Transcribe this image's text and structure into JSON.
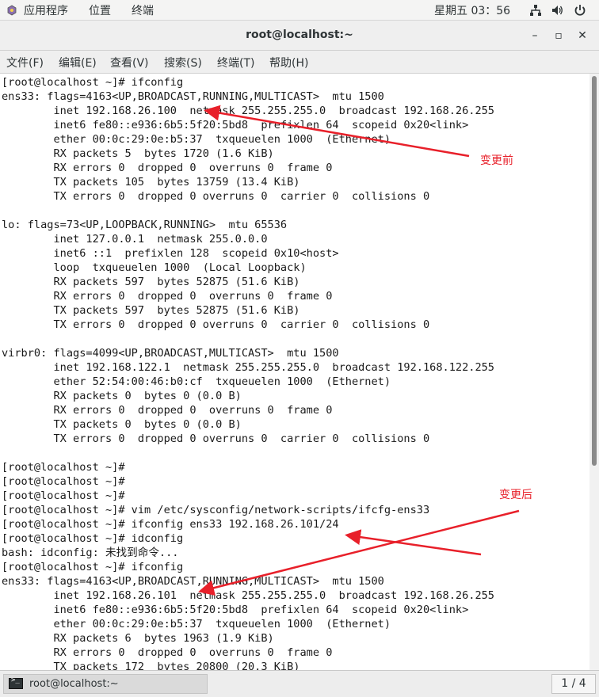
{
  "top_bar": {
    "apps_label": "应用程序",
    "places_label": "位置",
    "terminal_label": "终端",
    "clock": "星期五 03：56"
  },
  "window": {
    "title": "root@localhost:~",
    "minimize": "–",
    "maximize": "▫",
    "close": "✕"
  },
  "menu": [
    "文件(F)",
    "编辑(E)",
    "查看(V)",
    "搜索(S)",
    "终端(T)",
    "帮助(H)"
  ],
  "terminal_lines": [
    "[root@localhost ~]# ifconfig",
    "ens33: flags=4163<UP,BROADCAST,RUNNING,MULTICAST>  mtu 1500",
    "        inet 192.168.26.100  netmask 255.255.255.0  broadcast 192.168.26.255",
    "        inet6 fe80::e936:6b5:5f20:5bd8  prefixlen 64  scopeid 0x20<link>",
    "        ether 00:0c:29:0e:b5:37  txqueuelen 1000  (Ethernet)",
    "        RX packets 5  bytes 1720 (1.6 KiB)",
    "        RX errors 0  dropped 0  overruns 0  frame 0",
    "        TX packets 105  bytes 13759 (13.4 KiB)",
    "        TX errors 0  dropped 0 overruns 0  carrier 0  collisions 0",
    "",
    "lo: flags=73<UP,LOOPBACK,RUNNING>  mtu 65536",
    "        inet 127.0.0.1  netmask 255.0.0.0",
    "        inet6 ::1  prefixlen 128  scopeid 0x10<host>",
    "        loop  txqueuelen 1000  (Local Loopback)",
    "        RX packets 597  bytes 52875 (51.6 KiB)",
    "        RX errors 0  dropped 0  overruns 0  frame 0",
    "        TX packets 597  bytes 52875 (51.6 KiB)",
    "        TX errors 0  dropped 0 overruns 0  carrier 0  collisions 0",
    "",
    "virbr0: flags=4099<UP,BROADCAST,MULTICAST>  mtu 1500",
    "        inet 192.168.122.1  netmask 255.255.255.0  broadcast 192.168.122.255",
    "        ether 52:54:00:46:b0:cf  txqueuelen 1000  (Ethernet)",
    "        RX packets 0  bytes 0 (0.0 B)",
    "        RX errors 0  dropped 0  overruns 0  frame 0",
    "        TX packets 0  bytes 0 (0.0 B)",
    "        TX errors 0  dropped 0 overruns 0  carrier 0  collisions 0",
    "",
    "[root@localhost ~]#",
    "[root@localhost ~]#",
    "[root@localhost ~]#",
    "[root@localhost ~]# vim /etc/sysconfig/network-scripts/ifcfg-ens33",
    "[root@localhost ~]# ifconfig ens33 192.168.26.101/24",
    "[root@localhost ~]# idconfig",
    "bash: idconfig: 未找到命令...",
    "[root@localhost ~]# ifconfig",
    "ens33: flags=4163<UP,BROADCAST,RUNNING,MULTICAST>  mtu 1500",
    "        inet 192.168.26.101  netmask 255.255.255.0  broadcast 192.168.26.255",
    "        inet6 fe80::e936:6b5:5f20:5bd8  prefixlen 64  scopeid 0x20<link>",
    "        ether 00:0c:29:0e:b5:37  txqueuelen 1000  (Ethernet)",
    "        RX packets 6  bytes 1963 (1.9 KiB)",
    "        RX errors 0  dropped 0  overruns 0  frame 0",
    "        TX packets 172  bytes 20800 (20.3 KiB)"
  ],
  "annotations": {
    "before": "变更前",
    "after": "变更后",
    "color": "#e8202a"
  },
  "taskbar": {
    "task_label": "root@localhost:~",
    "pager": "1 / 4"
  }
}
